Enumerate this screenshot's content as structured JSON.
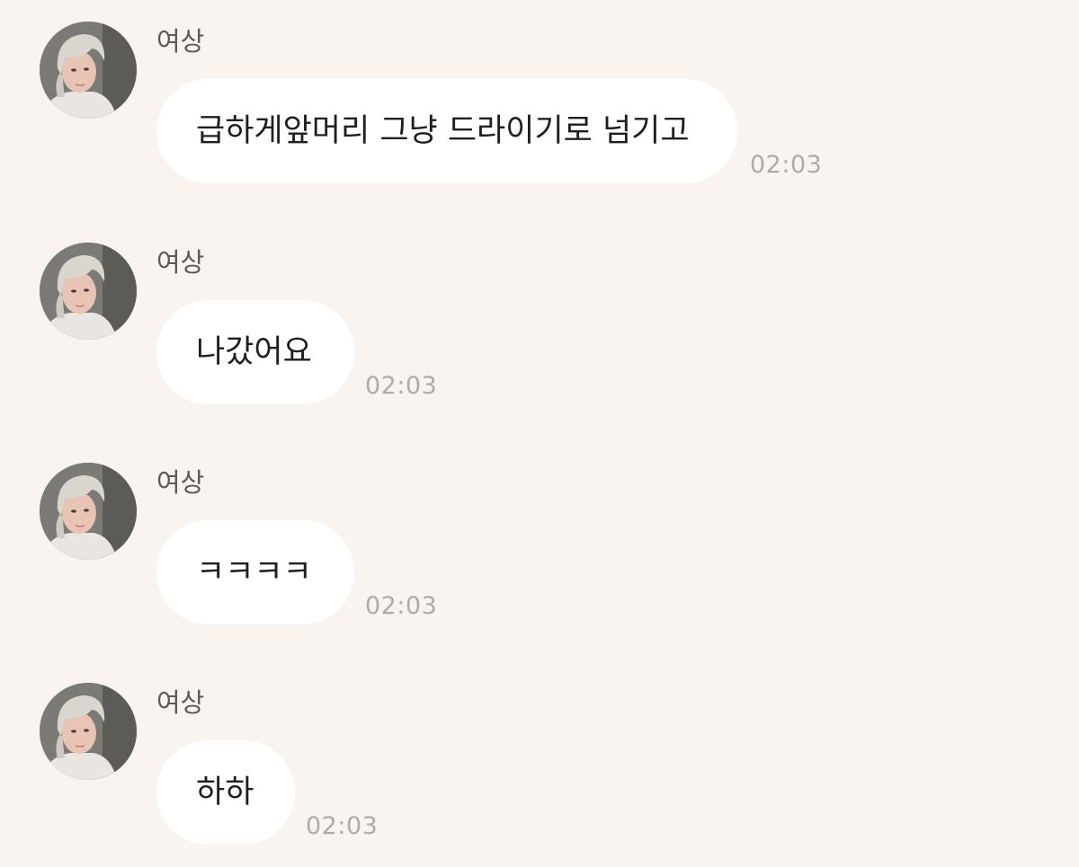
{
  "messages": [
    {
      "sender": "여상",
      "text": "급하게앞머리 그냥 드라이기로 넘기고",
      "time": "02:03"
    },
    {
      "sender": "여상",
      "text": "나갔어요",
      "time": "02:03"
    },
    {
      "sender": "여상",
      "text": "ㅋㅋㅋㅋ",
      "time": "02:03"
    },
    {
      "sender": "여상",
      "text": "하하",
      "time": "02:03"
    }
  ],
  "colors": {
    "background": "#f9f4ef",
    "bubble": "#ffffff",
    "timestamp": "#b0aba7",
    "sender_name": "#5e5955"
  },
  "icons": {
    "avatar": "profile-photo"
  }
}
